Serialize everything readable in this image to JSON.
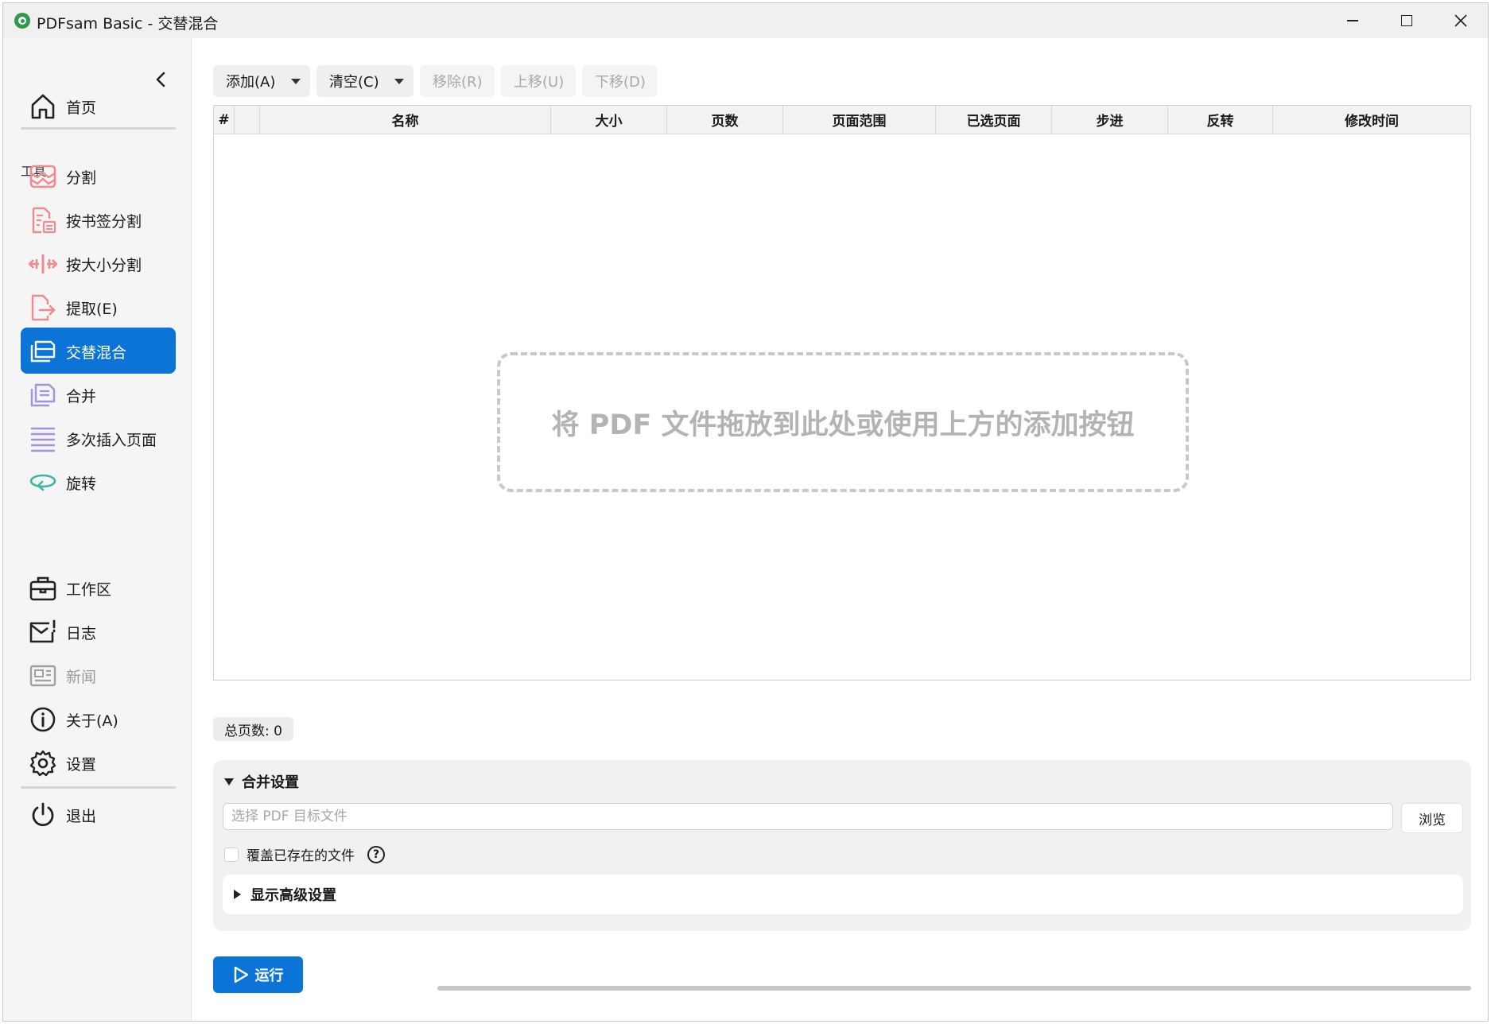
{
  "window": {
    "title": "PDFsam Basic - 交替混合"
  },
  "sidebar": {
    "home": {
      "label": "首页",
      "icon": "home-icon"
    },
    "tools_section_label": "工具",
    "tools": [
      {
        "label": "分割",
        "icon": "split-icon"
      },
      {
        "label": "按书签分割",
        "icon": "split-by-bookmarks-icon"
      },
      {
        "label": "按大小分割",
        "icon": "split-by-size-icon"
      },
      {
        "label": "提取(E)",
        "icon": "extract-icon"
      },
      {
        "label": "交替混合",
        "icon": "alternate-mix-icon",
        "active": true
      },
      {
        "label": "合并",
        "icon": "merge-icon"
      },
      {
        "label": "多次插入页面",
        "icon": "insert-pages-icon"
      },
      {
        "label": "旋转",
        "icon": "rotate-icon"
      }
    ],
    "bottom": [
      {
        "label": "工作区",
        "icon": "workspace-icon"
      },
      {
        "label": "日志",
        "icon": "log-icon"
      },
      {
        "label": "新闻",
        "icon": "news-icon",
        "disabled": true
      },
      {
        "label": "关于(A)",
        "icon": "info-icon"
      },
      {
        "label": "设置",
        "icon": "gear-icon"
      }
    ],
    "exit": {
      "label": "退出",
      "icon": "power-icon"
    }
  },
  "toolbar": {
    "add": "添加(A)",
    "clear": "清空(C)",
    "remove": "移除(R)",
    "move_up": "上移(U)",
    "move_down": "下移(D)"
  },
  "table": {
    "columns": [
      "#",
      "",
      "名称",
      "大小",
      "页数",
      "页面范围",
      "已选页面",
      "步进",
      "反转",
      "修改时间"
    ],
    "rows": [],
    "empty_hint": "将 PDF 文件拖放到此处或使用上方的添加按钮"
  },
  "total_pages": "总页数: 0",
  "settings": {
    "title": "合并设置",
    "destination_placeholder": "选择 PDF 目标文件",
    "destination_value": "",
    "browse": "浏览",
    "overwrite_label": "覆盖已存在的文件",
    "overwrite_checked": false,
    "help": "?",
    "advanced_toggle": "显示高级设置"
  },
  "run_button": "运行",
  "colors": {
    "accent": "#0b74d6",
    "sidebar_bg": "#f5f5f5",
    "icon_pink": "#ef8a8f",
    "icon_purple": "#a493d9",
    "icon_teal": "#3fb5a9"
  }
}
